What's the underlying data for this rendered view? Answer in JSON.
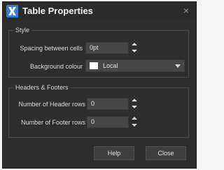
{
  "dialog": {
    "title": "Table Properties",
    "close_glyph": "×"
  },
  "style_group": {
    "legend": "Style",
    "spacing_label": "Spacing between cells",
    "spacing_value": "0pt",
    "background_label": "Background colour",
    "background_value": "Local",
    "background_swatch_color": "#ffffff"
  },
  "headers_group": {
    "legend": "Headers & Footers",
    "header_rows_label": "Number of Header rows",
    "header_rows_value": "0",
    "footer_rows_label": "Number of Footer rows",
    "footer_rows_value": "0"
  },
  "buttons": {
    "help_label": "Help",
    "close_label": "Close"
  },
  "icons": {
    "app": "app-x-logo-icon",
    "close": "close-icon",
    "spin_up": "chevron-up-icon",
    "spin_down": "chevron-down-icon",
    "dropdown": "dropdown-arrow-icon"
  },
  "colors": {
    "dialog_bg": "#2e2e2e",
    "accent_icon": "#2f7fdc"
  }
}
